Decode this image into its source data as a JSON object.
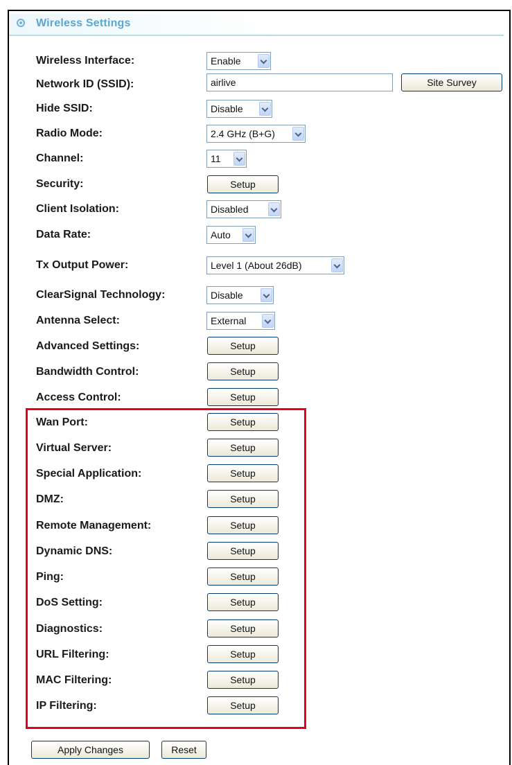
{
  "header": {
    "title": "Wireless Settings",
    "icon": "radio-bullet-icon"
  },
  "fields": {
    "wireless_interface": {
      "label": "Wireless Interface:",
      "value": "Enable"
    },
    "ssid": {
      "label": "Network ID (SSID):",
      "value": "airlive",
      "button": "Site Survey"
    },
    "hide_ssid": {
      "label": "Hide SSID:",
      "value": "Disable"
    },
    "radio_mode": {
      "label": "Radio Mode:",
      "value": "2.4 GHz (B+G)"
    },
    "channel": {
      "label": "Channel:",
      "value": "11"
    },
    "security": {
      "label": "Security:"
    },
    "client_isolation": {
      "label": "Client Isolation:",
      "value": "Disabled"
    },
    "data_rate": {
      "label": "Data Rate:",
      "value": "Auto"
    },
    "tx_output_power": {
      "label": "Tx Output Power:",
      "value": "Level 1 (About 26dB)"
    },
    "clearsignal": {
      "label": "ClearSignal Technology:",
      "value": "Disable"
    },
    "antenna_select": {
      "label": "Antenna Select:",
      "value": "External"
    },
    "advanced_settings": {
      "label": "Advanced Settings:"
    },
    "bandwidth_control": {
      "label": "Bandwidth Control:"
    },
    "access_control": {
      "label": "Access Control:"
    },
    "wan_port": {
      "label": "Wan Port:"
    },
    "virtual_server": {
      "label": "Virtual Server:"
    },
    "special_application": {
      "label": "Special Application:"
    },
    "dmz": {
      "label": "DMZ:"
    },
    "remote_management": {
      "label": "Remote Management:"
    },
    "dynamic_dns": {
      "label": "Dynamic DNS:"
    },
    "ping": {
      "label": "Ping:"
    },
    "dos_setting": {
      "label": "DoS Setting:"
    },
    "diagnostics": {
      "label": "Diagnostics:"
    },
    "url_filtering": {
      "label": "URL Filtering:"
    },
    "mac_filtering": {
      "label": "MAC Filtering:"
    },
    "ip_filtering": {
      "label": "IP Filtering:"
    }
  },
  "setup_label": "Setup",
  "actions": {
    "apply": "Apply Changes",
    "reset": "Reset"
  },
  "colors": {
    "title": "#5aa7cf",
    "highlight_box": "#e8001c"
  }
}
